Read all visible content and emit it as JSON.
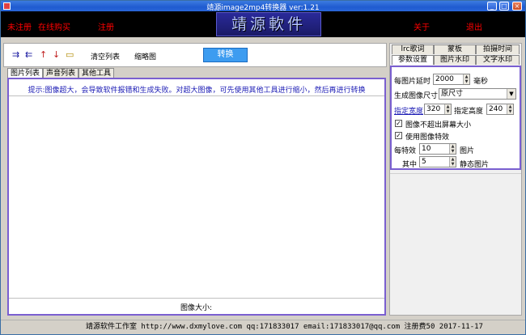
{
  "window": {
    "title": "靖源image2mp4转换器 ver:1.21",
    "minimize_glyph": "_",
    "maximize_glyph": "□",
    "close_glyph": "×"
  },
  "banner": {
    "links": [
      "未注册",
      "在线购买",
      "注册",
      "关于",
      "退出"
    ],
    "logo_text": "靖源軟件"
  },
  "toolbar": {
    "icons": [
      "add-files-icon",
      "remove-files-icon",
      "move-up-icon",
      "move-down-icon",
      "open-folder-icon"
    ],
    "clear_list_label": "清空列表",
    "thumbnail_label": "缩略图",
    "convert_label": "转换"
  },
  "left_tabs": [
    "图片列表",
    "声音列表",
    "其他工具"
  ],
  "list_panel": {
    "hint": "提示:图像超大，会导致软件报错和生成失败。对超大图像，可先使用其他工具进行缩小，然后再进行转换",
    "image_size_label": "图像大小:"
  },
  "right_tabs": {
    "row1": [
      "lrc歌词",
      "蒙板",
      "拍摄时间"
    ],
    "row2": [
      "参数设置",
      "图片水印",
      "文字水印"
    ]
  },
  "settings": {
    "delay_label": "每图片延时",
    "delay_value": "2000",
    "delay_unit": "毫秒",
    "size_label": "生成图像尺寸",
    "size_value": "原尺寸",
    "width_label": "指定宽度",
    "width_value": "320",
    "height_label": "指定高度",
    "height_value": "240",
    "fit_screen_label": "图像不超出屏幕大小",
    "fit_screen_checked": true,
    "effects_label": "使用图像特效",
    "effects_checked": true,
    "per_effect_label": "每特效",
    "per_effect_value": "10",
    "per_effect_unit": "图片",
    "static_label": "其中",
    "static_value": "5",
    "static_unit": "静态图片"
  },
  "footer": {
    "text": "靖源软件工作室 http://www.dxmylove.com qq:171833017 email:171833017@qq.com 注册费50 2017-11-17"
  },
  "colors": {
    "accent_border": "#7a5fd0",
    "hint_text": "#1a1ab4",
    "banner_link": "#ff0000",
    "convert_button": "#3d9cf0"
  }
}
